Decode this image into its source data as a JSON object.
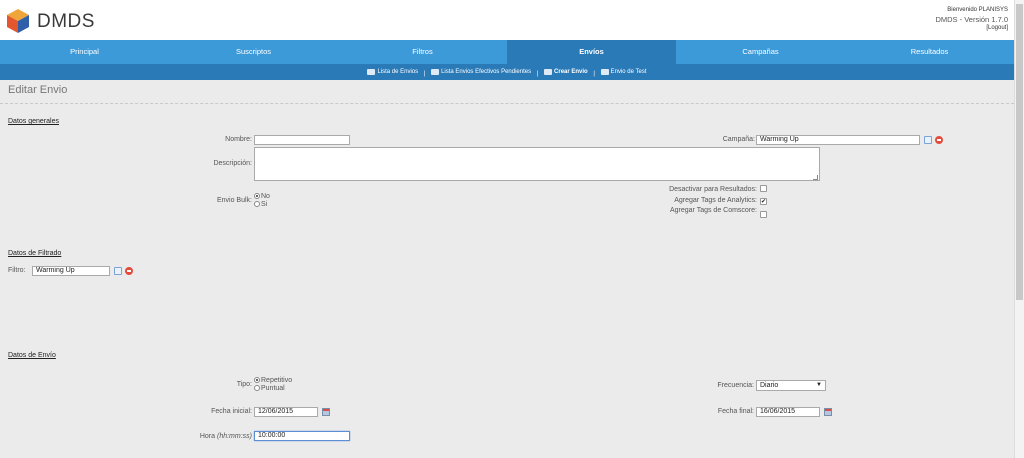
{
  "app": {
    "name": "DMDS"
  },
  "user": {
    "welcome": "Bienvenido PLANISYS",
    "version": "DMDS - Versión 1.7.0",
    "logout": "[Logout]"
  },
  "nav": {
    "tabs": [
      {
        "label": "Principal"
      },
      {
        "label": "Suscriptos"
      },
      {
        "label": "Filtros"
      },
      {
        "label": "Envíos",
        "active": true
      },
      {
        "label": "Campañas"
      },
      {
        "label": "Resultados"
      }
    ]
  },
  "subnav": {
    "items": [
      {
        "label": "Lista de Envios",
        "icon": "list-icon"
      },
      {
        "label": "Lista Envios Efectivos Pendientes",
        "icon": "pending-list-icon"
      },
      {
        "label": "Crear Envio",
        "icon": "create-envio-icon",
        "active": true
      },
      {
        "label": "Envio de Test",
        "icon": "test-envio-icon"
      }
    ],
    "separator": "|"
  },
  "page": {
    "title": "Editar Envio"
  },
  "general": {
    "section": "Datos generales",
    "nombre_label": "Nombre:",
    "nombre_value": "",
    "descripcion_label": "Descripción:",
    "descripcion_value": "",
    "envio_bulk_label": "Envio Bulk:",
    "envio_bulk_options": [
      "No",
      "Si"
    ],
    "envio_bulk_selected": "No",
    "campana_label": "Campaña:",
    "campana_value": "Warming Up",
    "desactivar_label": "Desactivar para Resultados:",
    "desactivar_checked": false,
    "analytics_label": "Agregar Tags de Analytics:",
    "analytics_checked": true,
    "comscore_label": "Agregar Tags de Comscore:",
    "comscore_checked": false
  },
  "filtrado": {
    "section": "Datos de Filtrado",
    "filtro_label": "Filtro:",
    "filtro_value": "Warming Up"
  },
  "envio": {
    "section": "Datos de Envío",
    "tipo_label": "Tipo:",
    "tipo_options": [
      "Repetitivo",
      "Puntual"
    ],
    "tipo_selected": "Repetitivo",
    "frecuencia_label": "Frecuencia:",
    "frecuencia_value": "Diario",
    "fecha_inicial_label": "Fecha inicial:",
    "fecha_inicial_value": "12/06/2015",
    "fecha_final_label": "Fecha final:",
    "fecha_final_value": "16/06/2015",
    "hora_label": "Hora",
    "hora_hint": "(hh:mm:ss)",
    "hora_value": "10:00:00"
  },
  "colors": {
    "nav_bg": "#3d9ad9",
    "nav_active": "#2b7ab8",
    "page_bg": "#ebebeb"
  }
}
